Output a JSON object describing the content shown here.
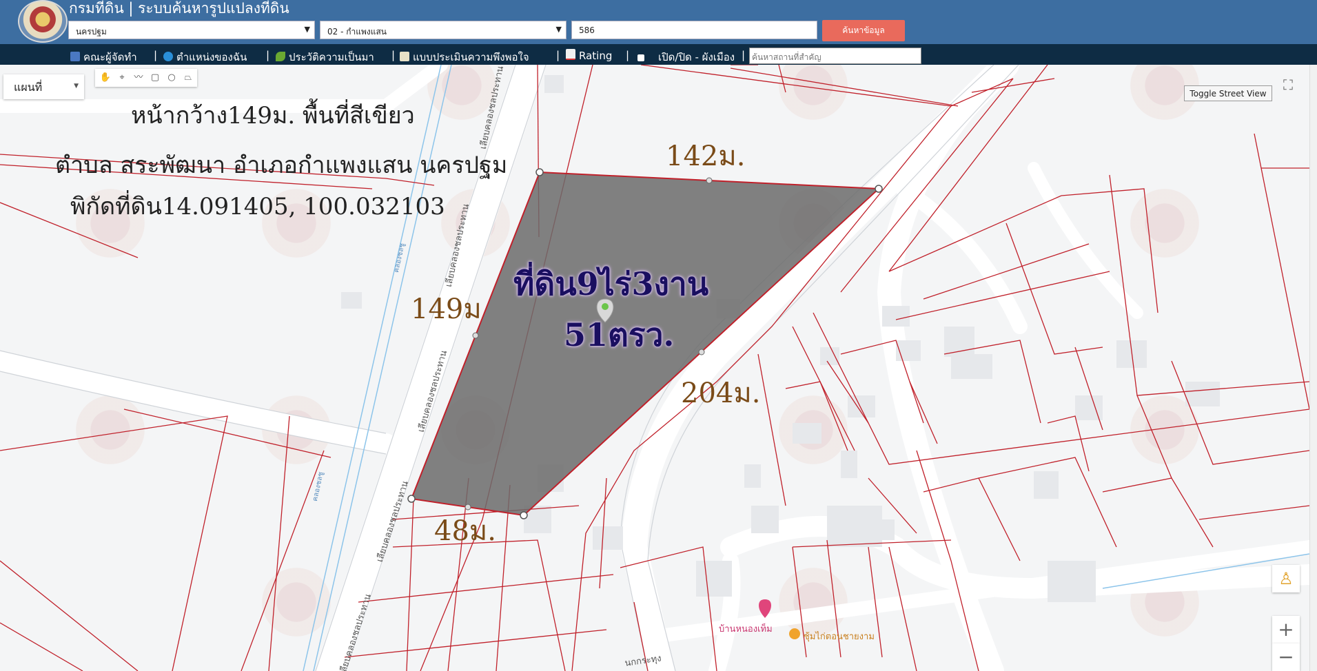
{
  "header": {
    "title": "กรมที่ดิน | ระบบค้นหารูปแปลงที่ดิน",
    "province": "นครปฐม",
    "district": "02 - กำแพงแสน",
    "parcel_number": "586",
    "search_button": "ค้นหาข้อมูล"
  },
  "navbar": {
    "items": [
      {
        "label": "คณะผู้จัดทำ",
        "icon": "team-icon"
      },
      {
        "label": "ตำแหน่งของฉัน",
        "icon": "globe-icon"
      },
      {
        "label": "ประวัติความเป็นมา",
        "icon": "sprout-icon"
      },
      {
        "label": "แบบประเมินความพึงพอใจ",
        "icon": "form-icon"
      },
      {
        "label": "Rating",
        "icon": "chart-icon"
      },
      {
        "label": "เปิด/ปิด - ผังเมือง",
        "icon": "checkbox-icon"
      }
    ],
    "separator": "|",
    "place_search_placeholder": "ค้นหาสถานที่สำคัญ"
  },
  "map": {
    "map_type": "แผนที่",
    "toggle_street_view": "Toggle Street View",
    "annotations": {
      "line1": "หน้ากว้าง149ม. พื้นที่สีเขียว",
      "line2": "ตำบล สระพัฒนา อำเภอกำแพงแสน นครปฐม",
      "line3": "พิกัดที่ดิน14.091405, 100.032103"
    },
    "area_label_line1": "ที่ดิน9ไร่3งาน",
    "area_label_line2": "51ตรว.",
    "dimensions": {
      "top": "142ม.",
      "left": "149ม",
      "right": "204ม.",
      "bottom": "48ม."
    },
    "road_labels": {
      "road_a": "เลียบคลองชลประทาน",
      "road_b": "เลียบคลองชลประทาน",
      "road_c": "เลียบคลองชลประทาน",
      "road_d": "เลียบคลองชลประทาน",
      "road_e": "เลียบคลองชลประทาน",
      "road_f": "นกกระทุง",
      "canal_a": "คลองชลชู",
      "canal_b": "คลองชลชู"
    },
    "pois": {
      "poi_1": "บ้านหนองเท็ม",
      "poi_2": "ซุ้มไก่ตอนชายงาม"
    },
    "zoom_in": "+",
    "zoom_out": "−"
  },
  "colors": {
    "header_bg": "#3d6ea1",
    "navbar_bg": "#0e2c44",
    "search_button_bg": "#e96a5c",
    "parcel_line": "#c0202a",
    "polygon_fill": "#6b6b6b",
    "area_label": "#1a0f60",
    "dimension_text": "#7a4b18"
  }
}
